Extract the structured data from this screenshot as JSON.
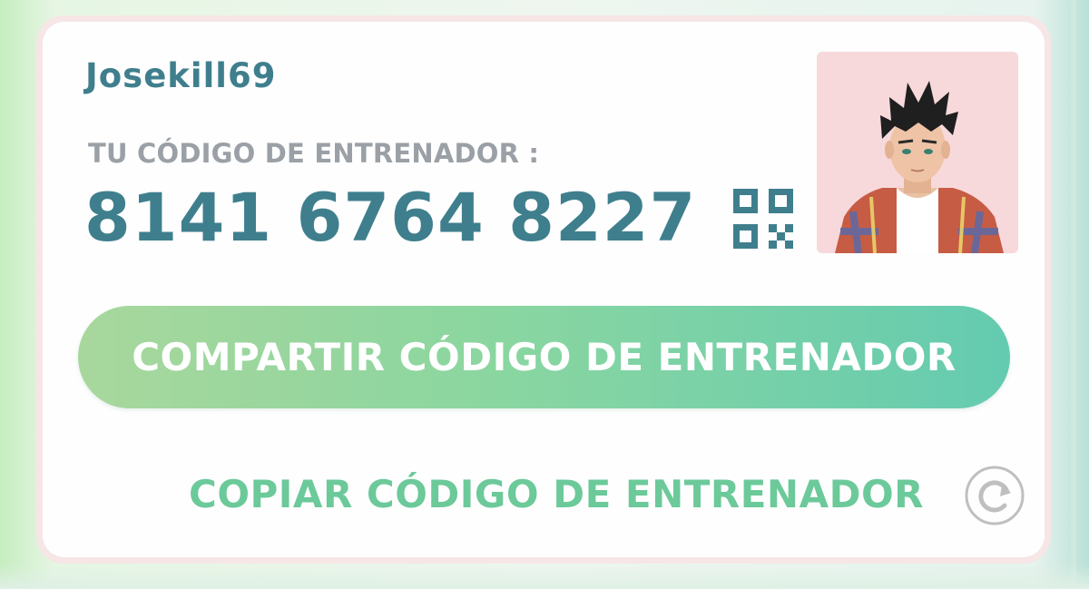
{
  "trainer": {
    "username": "Josekill69",
    "code_label": "TU CÓDIGO DE ENTRENADOR :",
    "code": "8141 6764 8227"
  },
  "actions": {
    "share_label": "COMPARTIR CÓDIGO DE ENTRENADOR",
    "copy_label": "COPIAR CÓDIGO DE ENTRENADOR"
  },
  "icons": {
    "qr": "qr-code-icon",
    "refresh": "refresh-icon",
    "avatar": "trainer-avatar"
  },
  "colors": {
    "primary_text": "#3f7f8d",
    "label_gray": "#9aa0a6",
    "button_gradient_start": "#a8d79c",
    "button_gradient_end": "#64cbb0",
    "link_green": "#6cc99a",
    "avatar_background": "#f7d9db"
  }
}
